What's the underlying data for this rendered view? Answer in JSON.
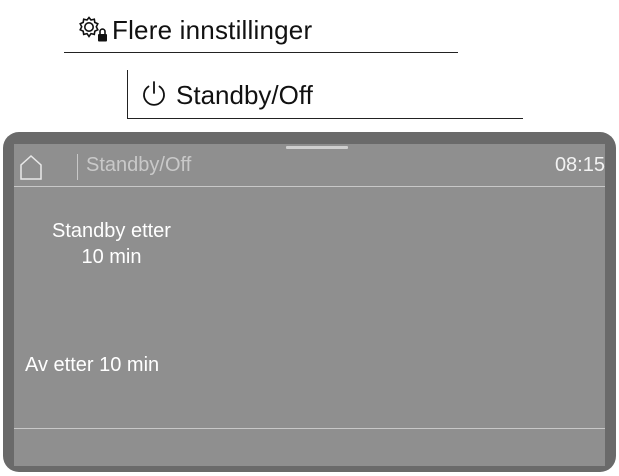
{
  "breadcrumb": {
    "item1": {
      "icon": "gear-lock-icon",
      "label": "Flere innstillinger"
    },
    "item2": {
      "icon": "power-icon",
      "label": "Standby/Off"
    }
  },
  "screen": {
    "home_icon": "home-icon",
    "title": "Standby/Off",
    "time": "08:15",
    "options": {
      "standby_line1": "Standby etter",
      "standby_line2": "10 min",
      "off": "Av etter 10 min"
    }
  },
  "colors": {
    "frame": "#6a6a6a",
    "screen_bg": "#8f8f8f",
    "text_primary": "#ffffff",
    "text_dim": "#c9c9c9"
  }
}
